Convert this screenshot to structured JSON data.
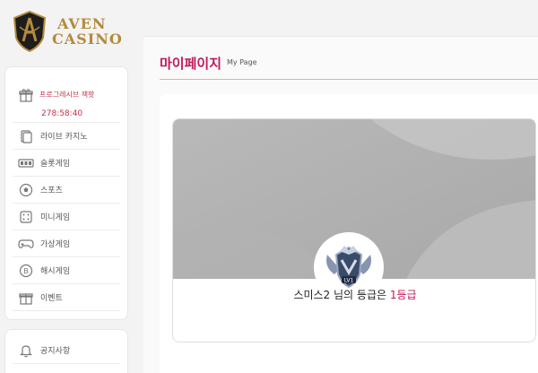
{
  "brand": {
    "line1": "AVEN",
    "line2": "CASINO"
  },
  "sidebar": {
    "promo_label": "프로그레시브 잭팟",
    "promo_timer": "278:58:40",
    "items": [
      {
        "label": "라이브 카지노",
        "icon": "cards-icon"
      },
      {
        "label": "슬롯게임",
        "icon": "slot-machine-icon"
      },
      {
        "label": "스포츠",
        "icon": "soccer-ball-icon"
      },
      {
        "label": "미니게임",
        "icon": "dice-icon"
      },
      {
        "label": "가상게임",
        "icon": "gamepad-icon"
      },
      {
        "label": "해시게임",
        "icon": "hash-coin-icon"
      },
      {
        "label": "이벤트",
        "icon": "gift-icon"
      }
    ],
    "secondary": [
      {
        "label": "공지사항",
        "icon": "bell-icon"
      }
    ]
  },
  "main": {
    "title": "마이페이지",
    "subtitle": "My Page",
    "grade_prefix": "스미스2 님의 등급은 ",
    "grade_value": "1등급",
    "badge_level": "LV1"
  },
  "colors": {
    "accent": "#c2185b",
    "gold": "#b48a3c"
  }
}
